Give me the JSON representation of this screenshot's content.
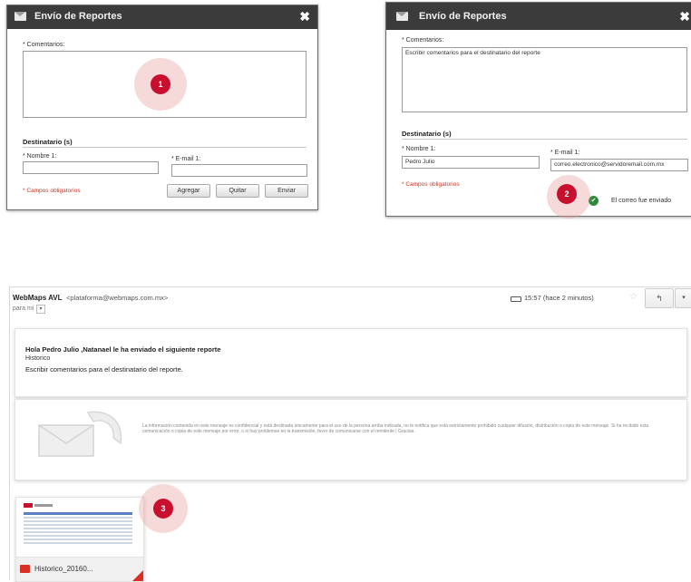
{
  "dialog1": {
    "title": "Envío de Reportes",
    "close": "✖",
    "comments_label": "* Comentarios:",
    "recipient_section": "Destinatario (s)",
    "name_label": "* Nombre 1:",
    "email_label": "* E-mail 1:",
    "required_note": "* Campos obligatorios",
    "buttons": [
      "Agregar",
      "Quitar",
      "Enviar"
    ],
    "step": "1"
  },
  "dialog2": {
    "title": "Envío de Reportes",
    "close": "✖",
    "comments_label": "* Comentarios:",
    "comments_value": "Escribir comentarios para el destinatario del reporte",
    "recipient_section": "Destinatario (s)",
    "name_label": "* Nombre 1:",
    "name_value": "Pedro Julio",
    "email_label": "* E-mail 1:",
    "email_value": "correo.electronico@servidoremail.com.mx",
    "required_note": "* Campos obligatorios",
    "sent_message": "El correo fue enviado",
    "step": "2"
  },
  "email": {
    "sender_name": "WebMaps AVL",
    "sender_address": "<plataforma@webmaps.com.mx>",
    "to": "para mí",
    "time": "15:57 (hace 2 minutos)",
    "greeting": "Hola Pedro Julio ,Natanael le ha enviado el siguiente reporte",
    "report_name": "Historico",
    "comment": "Escribir comentarios para el destinatario del reporte.",
    "disclaimer": "La información contenida en este mensaje es confidencial y está destinada únicamente para el uso de la persona arriba indicada, no le notifica que está estrictamente prohibido cualquier difusión, distribución o copia de este mensaje. Si ha recibido esta comunicación o copia de este mensaje por error, o si hay problemas en la transmisión, favor de comunicarse con el remitente | Gracias.",
    "attachment_name": "Historico_20160...",
    "step": "3"
  },
  "colors": {
    "header": "#3b3b3b",
    "badge": "#c8102e",
    "success": "#2e8b3a",
    "required": "#c0392b"
  }
}
